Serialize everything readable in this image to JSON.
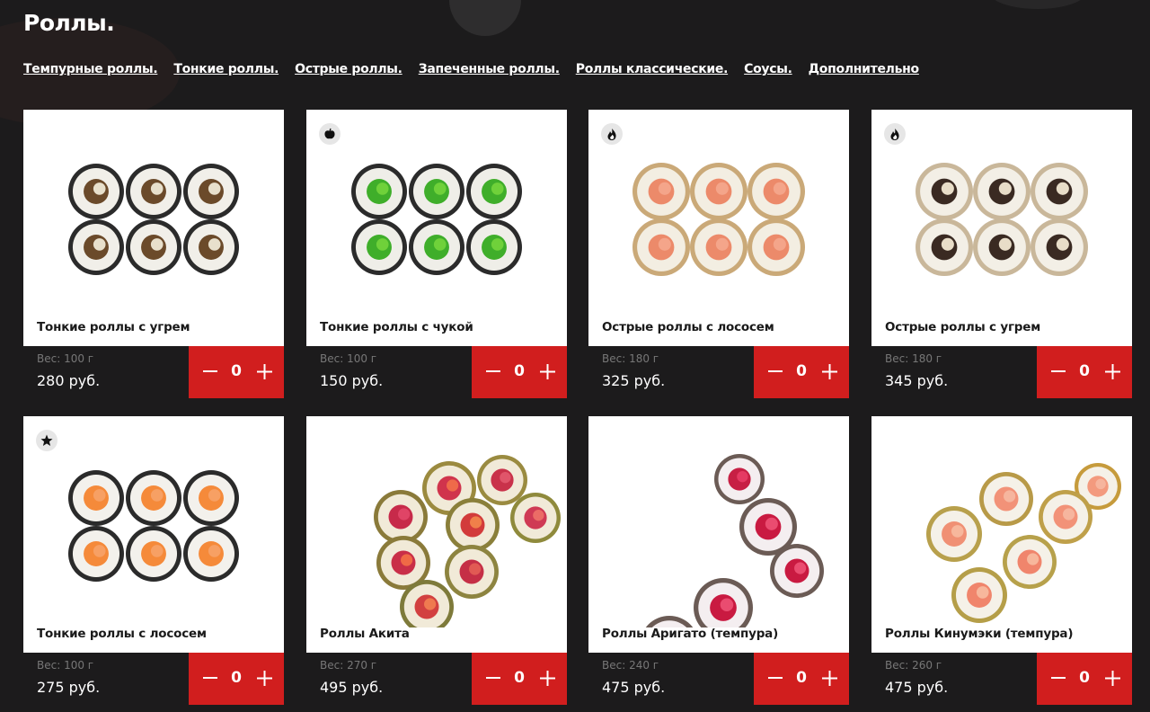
{
  "page": {
    "title": "Роллы."
  },
  "categories": [
    "Темпурные роллы.",
    "Тонкие роллы.",
    "Острые роллы.",
    "Запеченные роллы.",
    "Роллы классические.",
    "Соусы.",
    "Дополнительно"
  ],
  "products": [
    {
      "name": "Тонкие роллы с угрем",
      "weight": "Вес: 100 г",
      "price": "280 руб.",
      "qty": "0",
      "badge": "",
      "image": "eel-roll-icon"
    },
    {
      "name": "Тонкие роллы с чукой",
      "weight": "Вес: 100 г",
      "price": "150 руб.",
      "qty": "0",
      "badge": "vegetarian-apple-icon",
      "image": "chuka-roll-icon"
    },
    {
      "name": "Острые роллы с лососем",
      "weight": "Вес: 180 г",
      "price": "325 руб.",
      "qty": "0",
      "badge": "spicy-flame-icon",
      "image": "salmon-spicy-roll-icon"
    },
    {
      "name": "Острые роллы с угрем",
      "weight": "Вес: 180 г",
      "price": "345 руб.",
      "qty": "0",
      "badge": "spicy-flame-icon",
      "image": "eel-spicy-roll-icon"
    },
    {
      "name": "Тонкие роллы с лососем",
      "weight": "Вес: 100 г",
      "price": "275 руб.",
      "qty": "0",
      "badge": "star-icon",
      "image": "salmon-roll-icon"
    },
    {
      "name": "Роллы Акита",
      "weight": "Вес: 270 г",
      "price": "495 руб.",
      "qty": "0",
      "badge": "",
      "image": "akita-roll-icon"
    },
    {
      "name": "Роллы Аригато (темпура)",
      "weight": "Вес: 240 г",
      "price": "475 руб.",
      "qty": "0",
      "badge": "",
      "image": "arigato-tempura-roll-icon"
    },
    {
      "name": "Роллы Кинумэки (темпура)",
      "weight": "Вес: 260 г",
      "price": "475 руб.",
      "qty": "0",
      "badge": "",
      "image": "kinumeki-tempura-roll-icon"
    }
  ],
  "colors": {
    "background": "#1c1b1c",
    "card": "#ffffff",
    "accent_red": "#d11e1e",
    "weight_gray": "#777777"
  }
}
